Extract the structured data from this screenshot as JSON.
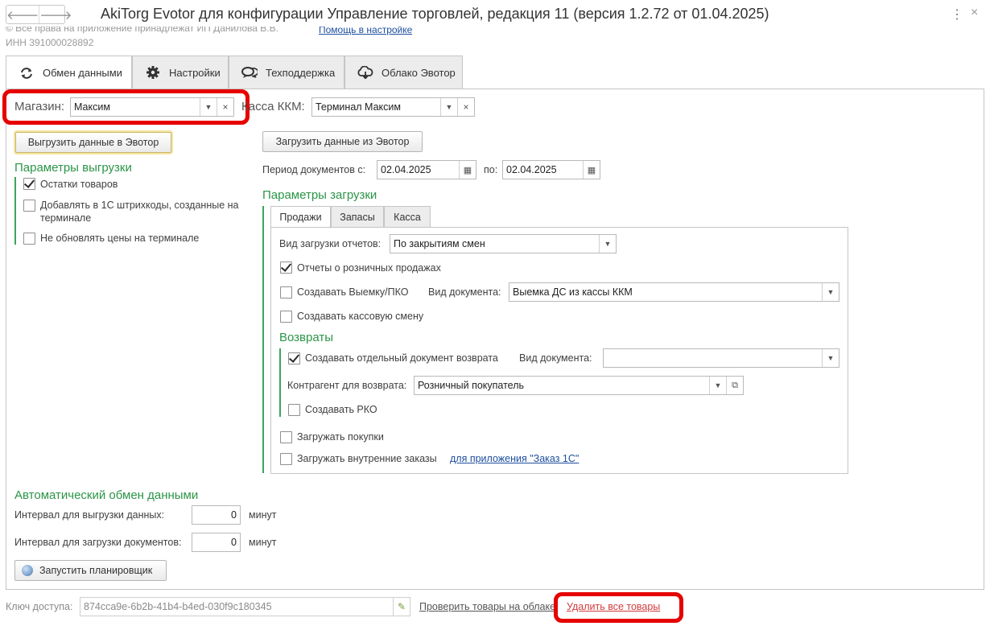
{
  "window": {
    "title": "AkiTorg Evotor для конфигурации Управление торговлей, редакция 11 (версия 1.2.72 от 01.04.2025)",
    "back_glyph": "🡐",
    "forward_glyph": "🡒",
    "menu_glyph": "⋮",
    "close_glyph": "×",
    "copyright": "© Все права на приложение принадлежат ИП Данилова В.В.",
    "inn": "ИНН 391000028892",
    "help_link": "Помощь в настройке"
  },
  "tabs": [
    {
      "label": "Обмен данными",
      "icon": "sync-icon",
      "active": true
    },
    {
      "label": "Настройки",
      "icon": "gear-icon",
      "active": false
    },
    {
      "label": "Техподдержка",
      "icon": "chat-icon",
      "active": false
    },
    {
      "label": "Облако Эвотор",
      "icon": "cloud-icon",
      "active": false
    }
  ],
  "exchange": {
    "store_label": "Магазин:",
    "store_value": "Максим",
    "kkm_label": "Касса ККМ:",
    "kkm_value": "Терминал Максим",
    "upload_button": "Выгрузить данные в Эвотор",
    "download_button": "Загрузить данные из Эвотор",
    "upload_params": {
      "title": "Параметры выгрузки",
      "items": [
        {
          "label": "Остатки товаров",
          "checked": true
        },
        {
          "label": "Добавлять в 1С штрихкоды, созданные на",
          "label2": "терминале",
          "checked": false
        },
        {
          "label": "Не обновлять цены на терминале",
          "checked": false
        }
      ]
    },
    "period": {
      "label": "Период  документов с:",
      "from": "02.04.2025",
      "to_label": "по:",
      "to": "02.04.2025"
    },
    "download_params": {
      "title": "Параметры загрузки",
      "subtabs": [
        "Продажи",
        "Запасы",
        "Касса"
      ],
      "report_mode_label": "Вид загрузки отчетов:",
      "report_mode_value": "По закрытиям смен",
      "retail_reports": {
        "label": "Отчеты о розничных продажах",
        "checked": true
      },
      "create_withdrawal": {
        "label": "Создавать Выемку/ПКО",
        "checked": false
      },
      "doc_type_label": "Вид документа:",
      "doc_type_value": "Выемка ДС из кассы ККМ",
      "create_shift": {
        "label": "Создавать кассовую смену",
        "checked": false
      },
      "returns": {
        "title": "Возвраты",
        "separate_doc": {
          "label": "Создавать отдельный документ возврата",
          "checked": true
        },
        "doc_type_label": "Вид  документа:",
        "doc_type_value": "",
        "counterparty_label": "Контрагент для возврата:",
        "counterparty_value": "Розничный покупатель",
        "create_rko": {
          "label": "Создавать РКО",
          "checked": false
        }
      },
      "load_purchases": {
        "label": "Загружать покупки",
        "checked": false
      },
      "load_internal_orders": {
        "label": "Загружать внутренние заказы",
        "checked": false
      },
      "orders_link": "для приложения \"Заказ 1С\""
    },
    "auto": {
      "title": "Автоматический обмен данными",
      "upload_interval_label": "Интервал для выгрузки данных:",
      "upload_interval_value": "0",
      "download_interval_label": "Интервал для загрузки документов:",
      "download_interval_value": "0",
      "unit": "минут",
      "scheduler_button": "Запустить планировщик"
    }
  },
  "footer": {
    "key_label": "Ключ доступа:",
    "key_value": "874cca9e-6b2b-41b4-b4ed-030f9c180345",
    "check_link": "Проверить товары на облаке",
    "delete_link": "Удалить все товары"
  },
  "colors": {
    "accent_green": "#2b9548",
    "highlight_red": "#e60000",
    "link_blue": "#1c4e9e"
  }
}
